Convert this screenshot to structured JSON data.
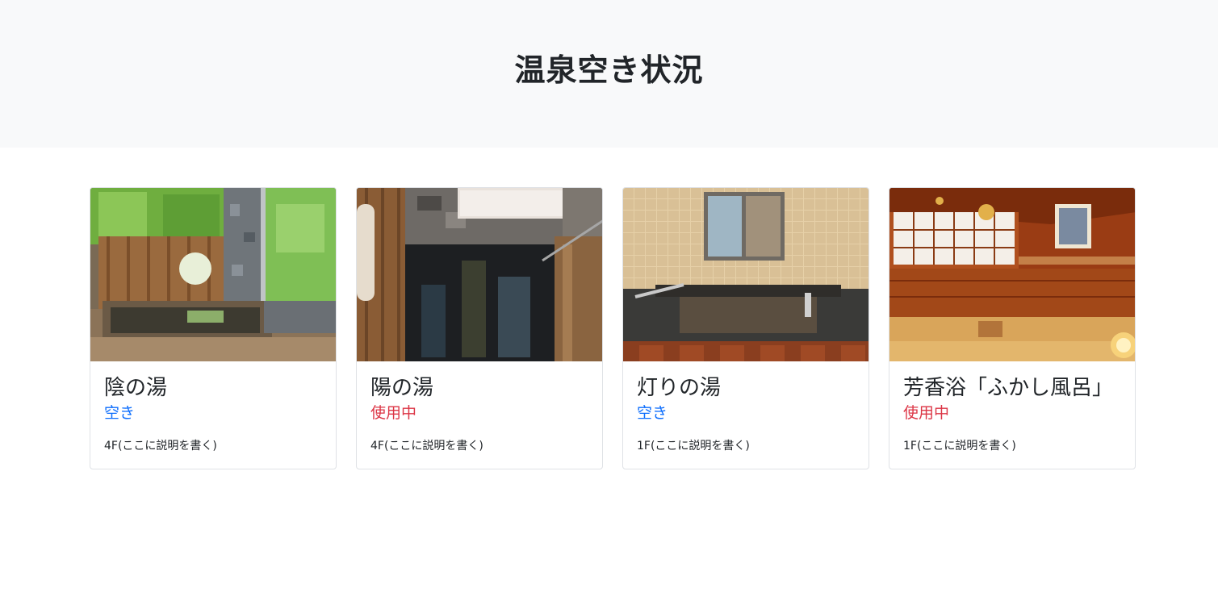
{
  "header": {
    "title": "温泉空き状況"
  },
  "colors": {
    "free": "#0d6efd",
    "busy": "#dc3545"
  },
  "cards": [
    {
      "title": "陰の湯",
      "status": "空き",
      "status_type": "free",
      "description": "4F(ここに説明を書く)"
    },
    {
      "title": "陽の湯",
      "status": "使用中",
      "status_type": "busy",
      "description": "4F(ここに説明を書く)"
    },
    {
      "title": "灯りの湯",
      "status": "空き",
      "status_type": "free",
      "description": "1F(ここに説明を書く)"
    },
    {
      "title": "芳香浴「ふかし風呂」",
      "status": "使用中",
      "status_type": "busy",
      "description": "1F(ここに説明を書く)"
    }
  ]
}
